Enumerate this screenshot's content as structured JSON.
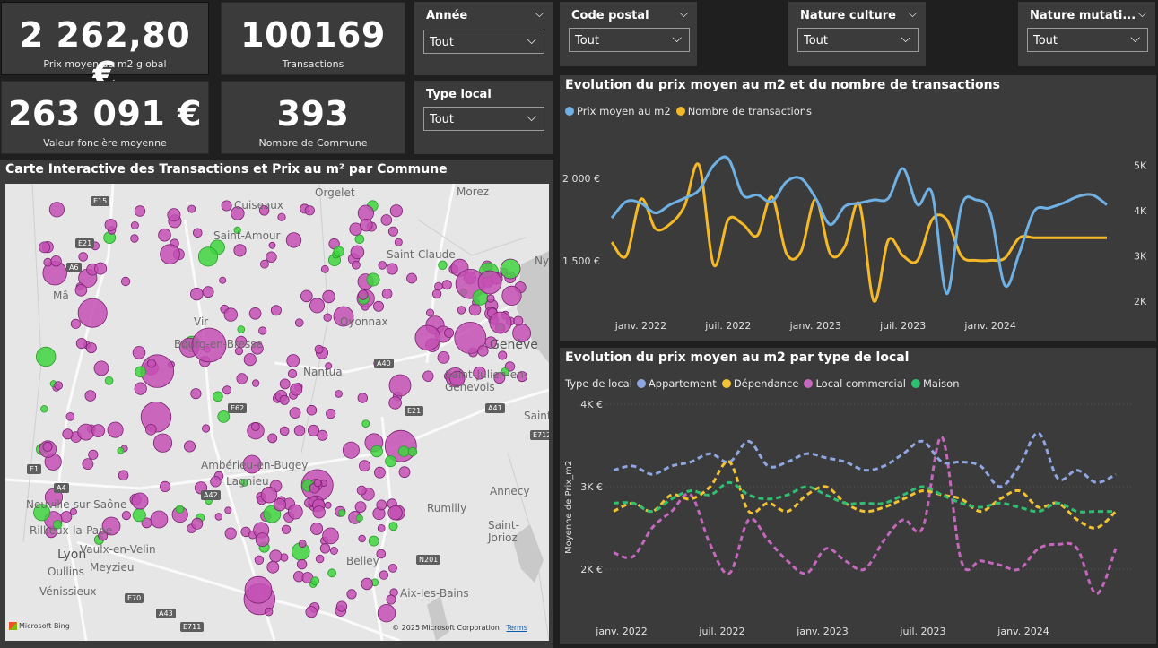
{
  "kpis": {
    "prix_moyen": {
      "value": "2 262,80 €",
      "label": "Prix moyen au m2 global"
    },
    "transactions": {
      "value": "100169",
      "label": "Transactions"
    },
    "valeur": {
      "value": "263 091 €",
      "label": "Valeur foncière moyenne"
    },
    "communes": {
      "value": "393",
      "label": "Nombre de Commune"
    }
  },
  "slicers": {
    "annee": {
      "title": "Année",
      "value": "Tout"
    },
    "type_local": {
      "title": "Type local",
      "value": "Tout"
    },
    "code_postal": {
      "title": "Code postal",
      "value": "Tout"
    },
    "nature_culture": {
      "title": "Nature culture",
      "value": "Tout"
    },
    "nature_mutation": {
      "title": "Nature mutati...",
      "value": "Tout"
    }
  },
  "map": {
    "title": "Carte Interactive des Transactions et Prix au m² par Commune",
    "labels": [
      "Orgelet",
      "Morez",
      "Cuiseaux",
      "Saint-Amour",
      "Saint-Claude",
      "Nyo",
      "Mâ",
      "Vir",
      "Bourg-en-Bresse",
      "Oyonnax",
      "Nantua",
      "Genève",
      "Saint-Julien-en-Genevois",
      "Saint",
      "Ambérieu-en-Bugey",
      "Lagnieu",
      "Annecy",
      "Neuville-sur-Saône",
      "Rumilly",
      "Saint-Jorioz",
      "Rillieux-la-Pape",
      "Lyon",
      "Vaulx-en-Velin",
      "Oullins",
      "Meyzieu",
      "Vénissieux",
      "Belley",
      "Aix-les-Bains"
    ],
    "roads": [
      "E15",
      "E21",
      "A6",
      "E62",
      "A40",
      "A41",
      "E712",
      "E21",
      "A42",
      "E70",
      "A43",
      "E711",
      "N201",
      "E1",
      "A4"
    ],
    "bing": "Microsoft Bing",
    "copyright": "© 2025 Microsoft Corporation",
    "terms": "Terms"
  },
  "chart1_title": "Evolution du prix moyen au m2 et du nombre de transactions",
  "chart2_title": "Evolution du prix moyen au m2 par type de local",
  "colors": {
    "prix": "#6fb1e4",
    "transactions": "#f5b826",
    "appartement": "#8fa6e0",
    "dependance": "#f2c233",
    "local_commercial": "#c468bd",
    "maison": "#2fbf71",
    "purple_bubble": "#c450b4",
    "green_bubble": "#3ed43e"
  },
  "chart_data": [
    {
      "type": "line",
      "title": "Evolution du prix moyen au m2 et du nombre de transactions",
      "x": [
        "2021-11",
        "2021-12",
        "2022-01",
        "2022-02",
        "2022-03",
        "2022-04",
        "2022-05",
        "2022-06",
        "2022-07",
        "2022-08",
        "2022-09",
        "2022-10",
        "2022-11",
        "2022-12",
        "2023-01",
        "2023-02",
        "2023-03",
        "2023-04",
        "2023-05",
        "2023-06",
        "2023-07",
        "2023-08",
        "2023-09",
        "2023-10",
        "2023-11",
        "2023-12",
        "2024-01",
        "2024-02",
        "2024-03",
        "2024-04",
        "2024-05",
        "2024-06",
        "2024-07",
        "2024-08",
        "2024-09"
      ],
      "x_ticks": [
        "janv. 2022",
        "juil. 2022",
        "janv. 2023",
        "juil. 2023",
        "janv. 2024"
      ],
      "series": [
        {
          "name": "Prix moyen au m2",
          "axis": "left",
          "values": [
            1760,
            1860,
            1850,
            1790,
            1840,
            1880,
            1930,
            2080,
            2120,
            1900,
            1900,
            1860,
            1980,
            2000,
            1880,
            1720,
            1830,
            1850,
            1870,
            1880,
            2060,
            1840,
            1910,
            1300,
            1830,
            1870,
            1790,
            1350,
            1550,
            1800,
            1820,
            1850,
            1890,
            1900,
            1840
          ],
          "ylim": [
            1200,
            2300
          ],
          "ticks": [
            "1 500 €",
            "2 000 €"
          ]
        },
        {
          "name": "Nombre de transactions",
          "axis": "right",
          "values": [
            3300,
            3000,
            4250,
            3600,
            3700,
            4100,
            5000,
            2800,
            3800,
            3700,
            3450,
            4300,
            3050,
            3100,
            4250,
            3050,
            3200,
            4150,
            2000,
            3350,
            3000,
            2900,
            3800,
            3800,
            3000,
            2900,
            2900,
            2950,
            3400,
            3400,
            3400,
            3400,
            3400,
            3400,
            3400
          ],
          "ylim": [
            1800,
            5800
          ],
          "ticks": [
            "2K",
            "3K",
            "4K",
            "5K"
          ]
        }
      ]
    },
    {
      "type": "line",
      "title": "Evolution du prix moyen au m2 par type de local",
      "legend_title": "Type de local",
      "ylabel": "Moyenne de Prix_m2",
      "y_ticks": [
        "2K €",
        "3K €",
        "4K €"
      ],
      "x_ticks": [
        "janv. 2022",
        "juil. 2022",
        "janv. 2023",
        "juil. 2023",
        "janv. 2024"
      ],
      "ylim": [
        1500,
        4000
      ],
      "series": [
        {
          "name": "Appartement",
          "values": [
            3200,
            3250,
            3150,
            3250,
            3300,
            3400,
            3300,
            3550,
            3250,
            3300,
            3400,
            3350,
            3300,
            3200,
            3250,
            3400,
            3550,
            3300,
            3300,
            3250,
            3000,
            3250,
            3650,
            3100,
            3200,
            3050,
            3150
          ]
        },
        {
          "name": "Dépendance",
          "values": [
            2700,
            2800,
            2700,
            2900,
            2850,
            3000,
            3300,
            2700,
            2800,
            2700,
            2900,
            3000,
            2800,
            2700,
            2750,
            2850,
            2950,
            2900,
            2850,
            2700,
            2850,
            2950,
            2750,
            2800,
            2600,
            2500,
            2700
          ]
        },
        {
          "name": "Local commercial",
          "values": [
            2200,
            2150,
            2500,
            2700,
            2900,
            2300,
            1950,
            2600,
            2350,
            2100,
            1950,
            2250,
            2100,
            2000,
            2350,
            2600,
            2500,
            3600,
            2100,
            2100,
            2050,
            2000,
            2250,
            2300,
            2250,
            1700,
            2250
          ]
        },
        {
          "name": "Maison",
          "values": [
            2800,
            2800,
            2700,
            2850,
            2950,
            2900,
            3050,
            2900,
            2850,
            2900,
            3000,
            2900,
            2800,
            2800,
            2800,
            2900,
            3000,
            2900,
            2800,
            2750,
            2800,
            2750,
            2700,
            2800,
            2700,
            2700,
            2700
          ]
        }
      ]
    }
  ]
}
